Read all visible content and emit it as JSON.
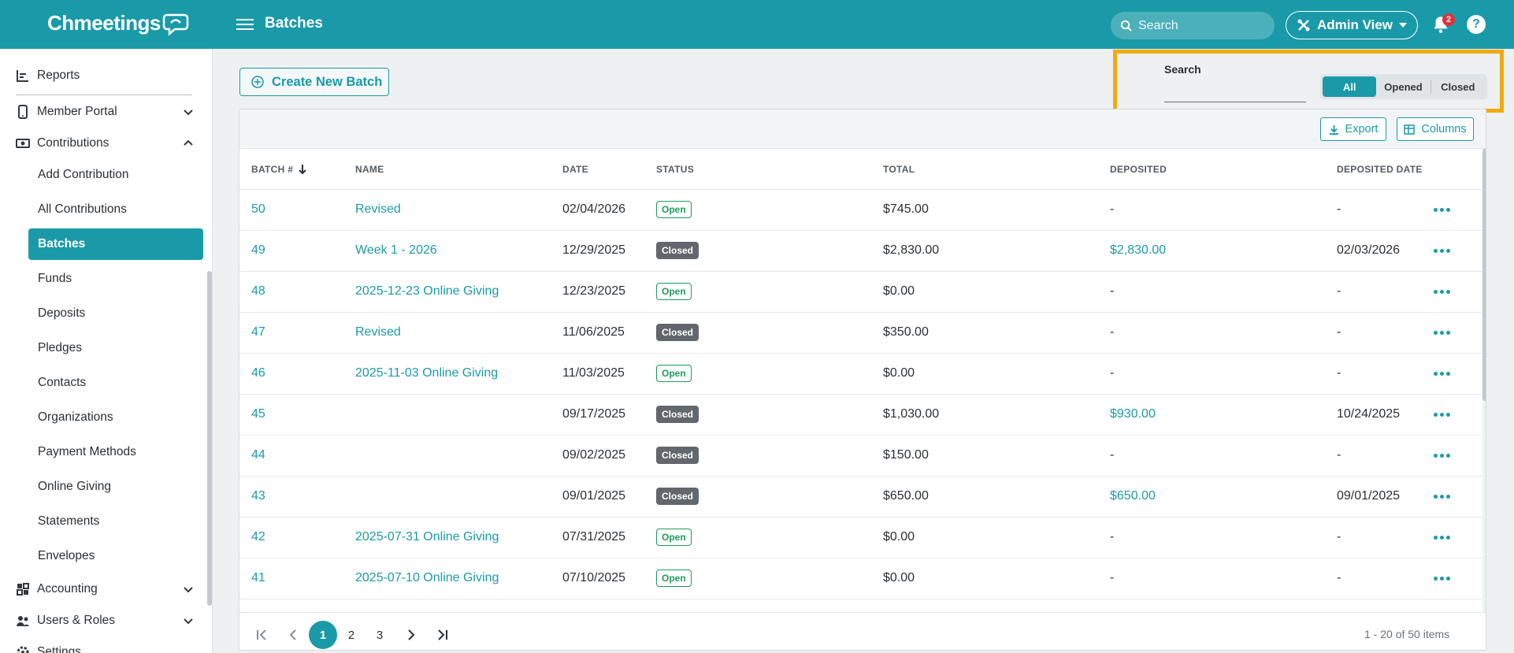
{
  "app": {
    "name": "Chmeetings",
    "page_title": "Batches"
  },
  "topbar": {
    "search_placeholder": "Search",
    "admin_view_label": "Admin View",
    "notification_count": "2",
    "help_label": "?"
  },
  "sidebar": {
    "items": [
      {
        "label": "Reports"
      },
      {
        "label": "Member Portal"
      },
      {
        "label": "Contributions"
      },
      {
        "label": "Accounting"
      },
      {
        "label": "Users & Roles"
      },
      {
        "label": "Settings"
      }
    ],
    "contributions_children": [
      {
        "label": "Add Contribution"
      },
      {
        "label": "All Contributions"
      },
      {
        "label": "Batches",
        "active": true
      },
      {
        "label": "Funds"
      },
      {
        "label": "Deposits"
      },
      {
        "label": "Pledges"
      },
      {
        "label": "Contacts"
      },
      {
        "label": "Organizations"
      },
      {
        "label": "Payment Methods"
      },
      {
        "label": "Online Giving"
      },
      {
        "label": "Statements"
      },
      {
        "label": "Envelopes"
      }
    ]
  },
  "content": {
    "create_button_label": "Create New Batch",
    "filter": {
      "search_label": "Search",
      "segments": [
        "All",
        "Opened",
        "Closed"
      ],
      "selected": "All"
    },
    "toolbar": {
      "export_label": "Export",
      "columns_label": "Columns"
    },
    "columns": [
      "BATCH #",
      "NAME",
      "DATE",
      "STATUS",
      "TOTAL",
      "DEPOSITED",
      "DEPOSITED DATE"
    ],
    "rows": [
      {
        "batch": "50",
        "name": "Revised",
        "date": "02/04/2026",
        "status": "Open",
        "total": "$745.00",
        "deposited": "-",
        "deposited_date": "-"
      },
      {
        "batch": "49",
        "name": "Week 1 - 2026",
        "date": "12/29/2025",
        "status": "Closed",
        "total": "$2,830.00",
        "deposited": "$2,830.00",
        "deposited_date": "02/03/2026"
      },
      {
        "batch": "48",
        "name": "2025-12-23 Online Giving",
        "date": "12/23/2025",
        "status": "Open",
        "total": "$0.00",
        "deposited": "-",
        "deposited_date": "-"
      },
      {
        "batch": "47",
        "name": "Revised",
        "date": "11/06/2025",
        "status": "Closed",
        "total": "$350.00",
        "deposited": "-",
        "deposited_date": "-"
      },
      {
        "batch": "46",
        "name": "2025-11-03 Online Giving",
        "date": "11/03/2025",
        "status": "Open",
        "total": "$0.00",
        "deposited": "-",
        "deposited_date": "-"
      },
      {
        "batch": "45",
        "name": "",
        "date": "09/17/2025",
        "status": "Closed",
        "total": "$1,030.00",
        "deposited": "$930.00",
        "deposited_date": "10/24/2025"
      },
      {
        "batch": "44",
        "name": "",
        "date": "09/02/2025",
        "status": "Closed",
        "total": "$150.00",
        "deposited": "-",
        "deposited_date": "-"
      },
      {
        "batch": "43",
        "name": "",
        "date": "09/01/2025",
        "status": "Closed",
        "total": "$650.00",
        "deposited": "$650.00",
        "deposited_date": "09/01/2025"
      },
      {
        "batch": "42",
        "name": "2025-07-31 Online Giving",
        "date": "07/31/2025",
        "status": "Open",
        "total": "$0.00",
        "deposited": "-",
        "deposited_date": "-"
      },
      {
        "batch": "41",
        "name": "2025-07-10 Online Giving",
        "date": "07/10/2025",
        "status": "Open",
        "total": "$0.00",
        "deposited": "-",
        "deposited_date": "-"
      }
    ],
    "pager": {
      "pages": [
        "1",
        "2",
        "3"
      ],
      "current": "1",
      "info": "1 - 20 of 50 items"
    }
  },
  "colors": {
    "brand": "#1a9aa8",
    "highlight": "#f0aa10",
    "open": "#1f9b5a",
    "closed": "#62676d"
  }
}
